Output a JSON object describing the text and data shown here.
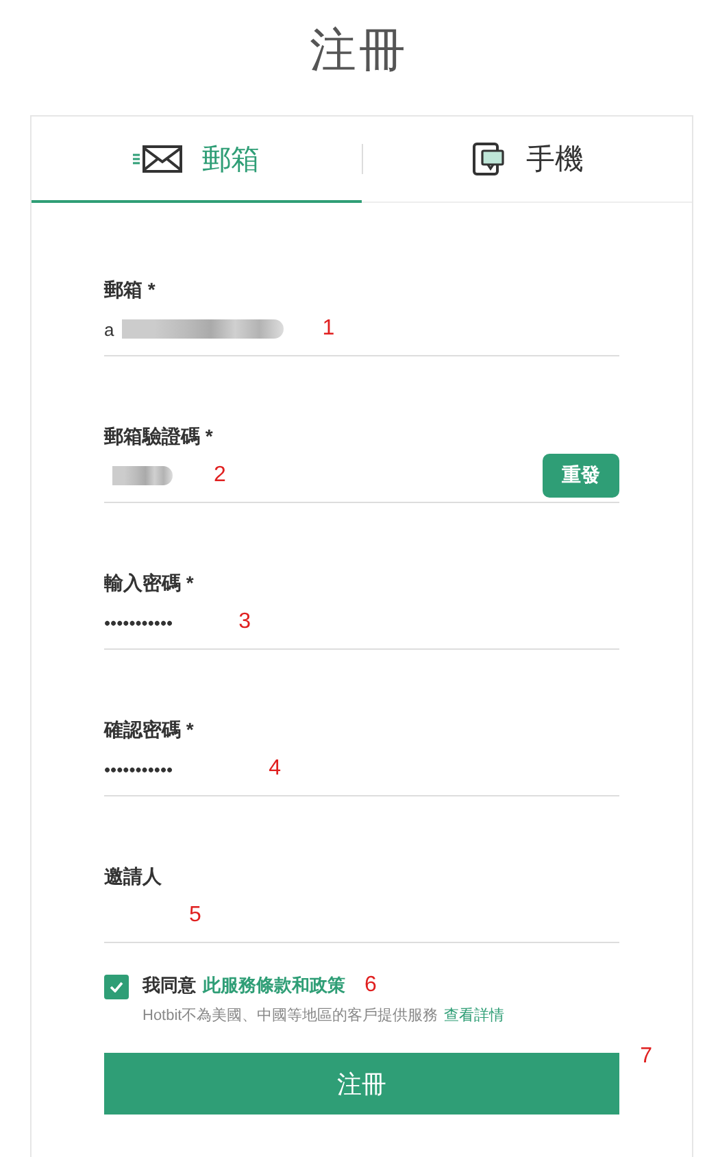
{
  "title": "注冊",
  "tabs": [
    {
      "label": "郵箱",
      "kind": "email",
      "selected": true
    },
    {
      "label": "手機",
      "kind": "phone",
      "selected": false
    }
  ],
  "fields": [
    {
      "label": "郵箱 *",
      "kind": "text",
      "value": "a",
      "redacted": true,
      "annotation": "1"
    },
    {
      "label": "郵箱驗證碼 *",
      "kind": "code",
      "redacted": true,
      "button": "重發",
      "annotation": "2"
    },
    {
      "label": "輸入密碼 *",
      "kind": "password",
      "value": "•••••••••••",
      "annotation": "3"
    },
    {
      "label": "確認密碼 *",
      "kind": "password",
      "value": "•••••••••••",
      "annotation": "4"
    },
    {
      "label": "邀請人",
      "kind": "text",
      "annotation": "5"
    }
  ],
  "agreement": {
    "checked": true,
    "text": "我同意",
    "link": "此服務條款和政策",
    "annotation": "6",
    "notice": "Hotbit不為美國、中國等地區的客戶提供服務",
    "notice_link": "查看詳情"
  },
  "submit": {
    "label": "注冊",
    "annotation": "7"
  }
}
